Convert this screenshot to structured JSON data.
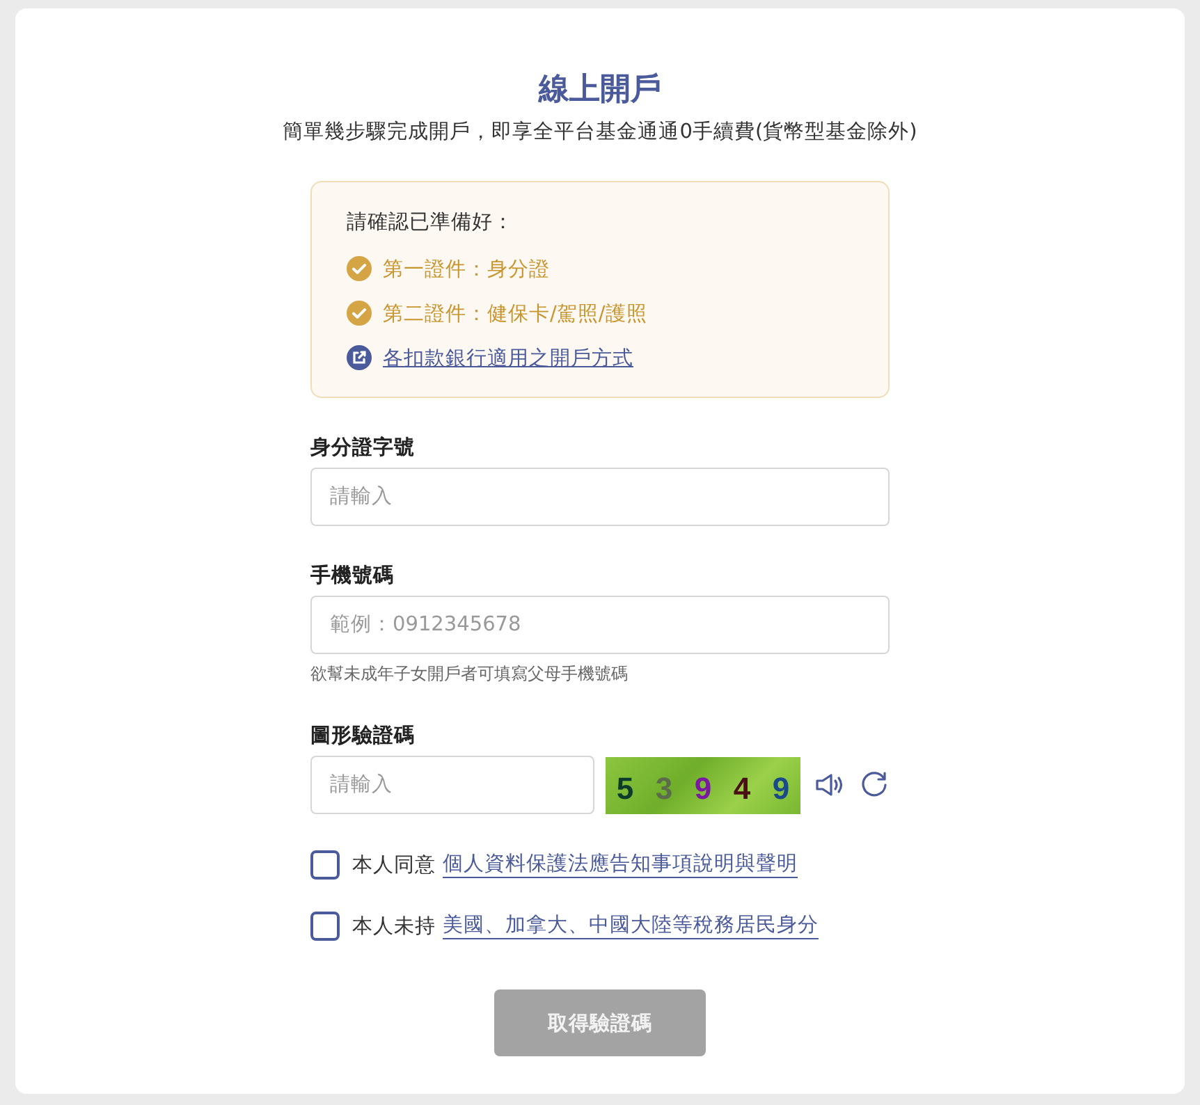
{
  "title": "線上開戶",
  "subtitle": "簡單幾步驟完成開戶，即享全平台基金通通0手續費(貨幣型基金除外)",
  "notice": {
    "heading": "請確認已準備好：",
    "items": [
      {
        "kind": "check",
        "text": "第一證件：身分證"
      },
      {
        "kind": "check",
        "text": "第二證件：健保卡/駕照/護照"
      },
      {
        "kind": "link",
        "text": "各扣款銀行適用之開戶方式"
      }
    ]
  },
  "fields": [
    {
      "label": "身分證字號",
      "placeholder": "請輸入"
    },
    {
      "label": "手機號碼",
      "placeholder": "範例：0912345678",
      "hint": "欲幫未成年子女開戶者可填寫父母手機號碼"
    }
  ],
  "captcha": {
    "label": "圖形驗證碼",
    "placeholder": "請輸入",
    "digits": [
      {
        "text": "5",
        "color": "#0c3b2c"
      },
      {
        "text": "3",
        "color": "#5b6b4c"
      },
      {
        "text": "9",
        "color": "#7a1aa0"
      },
      {
        "text": "4",
        "color": "#4a0f14"
      },
      {
        "text": "9",
        "color": "#1a4a8a"
      }
    ]
  },
  "agreements": [
    {
      "checked": false,
      "prefix": "本人同意",
      "link": "個人資料保護法應告知事項說明與聲明"
    },
    {
      "checked": false,
      "prefix": "本人未持",
      "link": "美國、加拿大、中國大陸等稅務居民身分"
    }
  ],
  "submit": {
    "label": "取得驗證碼",
    "disabled": true
  }
}
